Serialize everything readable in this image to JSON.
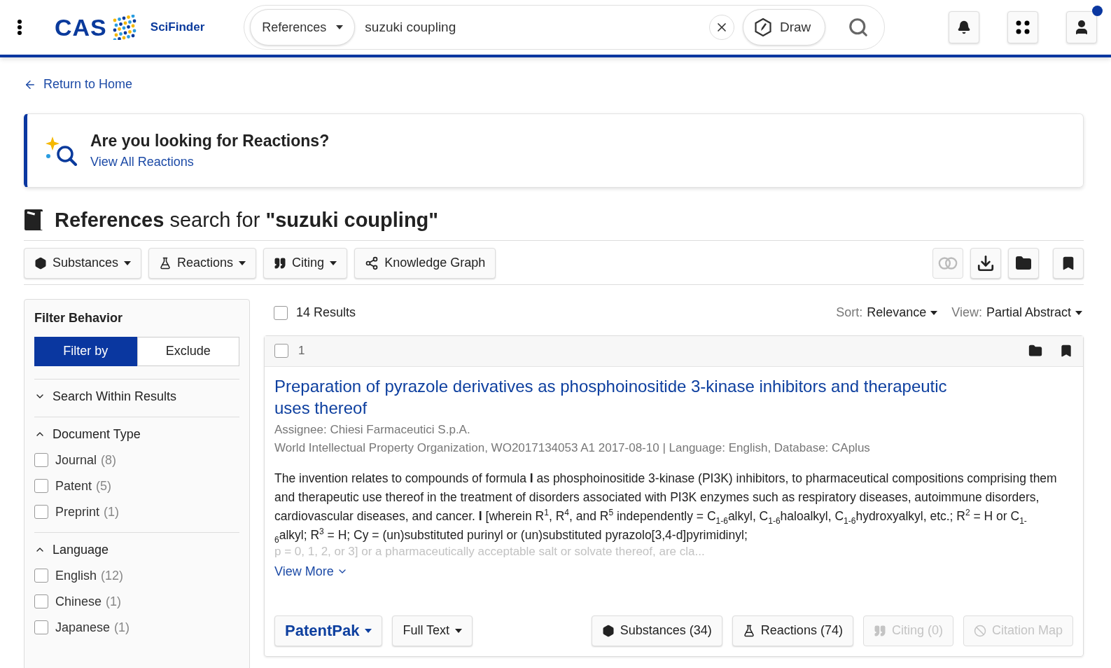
{
  "header": {
    "logo": "CAS",
    "product": "SciFinder",
    "search": {
      "scope": "References",
      "value": "suzuki coupling",
      "draw": "Draw"
    },
    "account_badge": true
  },
  "back_link": "Return to Home",
  "banner": {
    "title": "Are you looking for Reactions?",
    "link": "View All Reactions"
  },
  "page_title": {
    "bold": "References",
    "middle": "search for",
    "query": "\"suzuki coupling\""
  },
  "toolbar": {
    "buttons": [
      {
        "kind": "substances",
        "label": "Substances",
        "dropdown": true
      },
      {
        "kind": "reactions",
        "label": "Reactions",
        "dropdown": true
      },
      {
        "kind": "citing",
        "label": "Citing",
        "dropdown": true
      },
      {
        "kind": "graph",
        "label": "Knowledge Graph",
        "dropdown": false
      }
    ],
    "actions": [
      {
        "kind": "compare",
        "disabled": true
      },
      {
        "kind": "download",
        "disabled": false
      },
      {
        "kind": "folder",
        "disabled": false
      },
      {
        "kind": "bookmark",
        "disabled": false
      }
    ]
  },
  "sidebar": {
    "title": "Filter Behavior",
    "modes": [
      {
        "label": "Filter by",
        "selected": true
      },
      {
        "label": "Exclude",
        "selected": false
      }
    ],
    "sections": [
      {
        "title": "Search Within Results",
        "expanded": false
      },
      {
        "title": "Document Type",
        "expanded": true,
        "items": [
          {
            "label": "Journal",
            "count": "(8)",
            "checked": false
          },
          {
            "label": "Patent",
            "count": "(5)",
            "checked": false
          },
          {
            "label": "Preprint",
            "count": "(1)",
            "checked": false
          }
        ]
      },
      {
        "title": "Language",
        "expanded": true,
        "items": [
          {
            "label": "English",
            "count": "(12)",
            "checked": false
          },
          {
            "label": "Chinese",
            "count": "(1)",
            "checked": false
          },
          {
            "label": "Japanese",
            "count": "(1)",
            "checked": false
          }
        ]
      }
    ]
  },
  "results": {
    "count": "14 Results",
    "select_all": false,
    "sort_label": "Sort:",
    "sort": "Relevance",
    "view_label": "View:",
    "view": "Partial Abstract",
    "items": [
      {
        "number": "1",
        "checked": false,
        "title": "Preparation of pyrazole derivatives as phosphoinositide 3-kinase inhibitors and therapeutic uses thereof",
        "assignee": "Assignee: Chiesi Farmaceutici S.p.A.",
        "source": "World Intellectual Property Organization, WO2017134053 A1 2017-08-10 | Language: English, Database: CAplus",
        "abstract": "The invention relates to compounds of formula **I** as phosphoinositide 3-kinase (PI3K) inhibitors, to pharmaceutical compositions comprising them and therapeutic use thereof in the treatment of disorders associated with PI3K enzymes such as respiratory diseases, autoimmune disorders, cardiovascular diseases, and cancer. **I** [wherein R$^{1}$, R$^{4}$, and R$^{5}$ independently = C$_{1-6}$alkyl, C$_{1-6}$haloalkyl, C$_{1-6}$hydroxyalkyl, etc.; R$^{2}$ = H or C$_{1-6}$alkyl; R$^{3}$ = H; Cy = (un)substituted purinyl or (un)substituted pyrazolo[3,4-d]pyrimidinyl;",
        "abstract_tail": "p = 0, 1, 2, or 3] or a pharmaceutically acceptable salt or solvate thereof, are cla...",
        "view_more": "View More",
        "links": [
          {
            "kind": "patentpak",
            "label": "PatentPak",
            "disabled": false
          },
          {
            "kind": "fulltext",
            "label": "Full Text",
            "disabled": false
          }
        ],
        "actions": [
          {
            "kind": "substances",
            "label": "Substances (34)",
            "disabled": false
          },
          {
            "kind": "reactions",
            "label": "Reactions (74)",
            "disabled": false
          },
          {
            "kind": "citing",
            "label": "Citing (0)",
            "disabled": true
          },
          {
            "kind": "map",
            "label": "Citation Map",
            "disabled": true
          }
        ]
      }
    ]
  }
}
